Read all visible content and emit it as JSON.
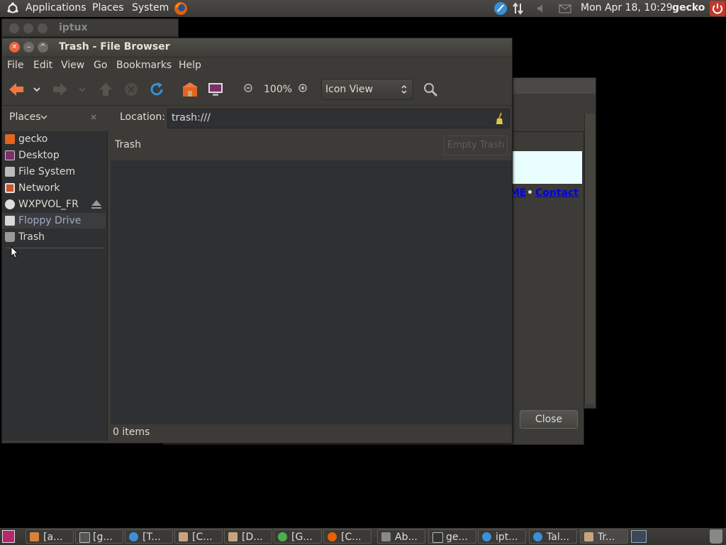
{
  "top_panel": {
    "menus": [
      "Applications",
      "Places",
      "System"
    ],
    "clock": "Mon Apr 18, 10:29",
    "user": "gecko",
    "icons": [
      "ubuntu-logo-icon",
      "firefox-icon",
      "messaging-icon",
      "network-icon",
      "volume-icon",
      "mail-icon",
      "power-icon"
    ]
  },
  "bg_window": {
    "title": "iptux"
  },
  "behind_dialog": {
    "link_partial": "ME",
    "bullet": "•",
    "link_contact": "Contact",
    "close_label": "Close"
  },
  "window": {
    "title": "Trash - File Browser",
    "menu": [
      "File",
      "Edit",
      "View",
      "Go",
      "Bookmarks",
      "Help"
    ],
    "toolbar": {
      "zoom": "100%",
      "view_mode": "Icon View",
      "icons": [
        "back-icon",
        "forward-icon",
        "up-icon",
        "stop-icon",
        "reload-icon",
        "home-icon",
        "computer-icon",
        "zoom-out-icon",
        "zoom-in-icon",
        "search-icon"
      ]
    },
    "places_label": "Places",
    "location_label": "Location:",
    "location_value": "trash:///",
    "sidebar_items": [
      "gecko",
      "Desktop",
      "File System",
      "Network",
      "WXPVOL_FR",
      "Floppy Drive",
      "Trash"
    ],
    "content_header": "Trash",
    "empty_trash_label": "Empty Trash",
    "status": "0 items"
  },
  "taskbar": {
    "items": [
      "[a...",
      "[g...",
      "[T...",
      "[C...",
      "[D...",
      "[G...",
      "[C...",
      "Ab...",
      "ge...",
      "ipt...",
      "Tal...",
      "Tr..."
    ]
  },
  "colors": {
    "accent": "#f07746",
    "panel": "#3c3b37",
    "content_bg": "#2e3033",
    "link": "#0000ee"
  }
}
